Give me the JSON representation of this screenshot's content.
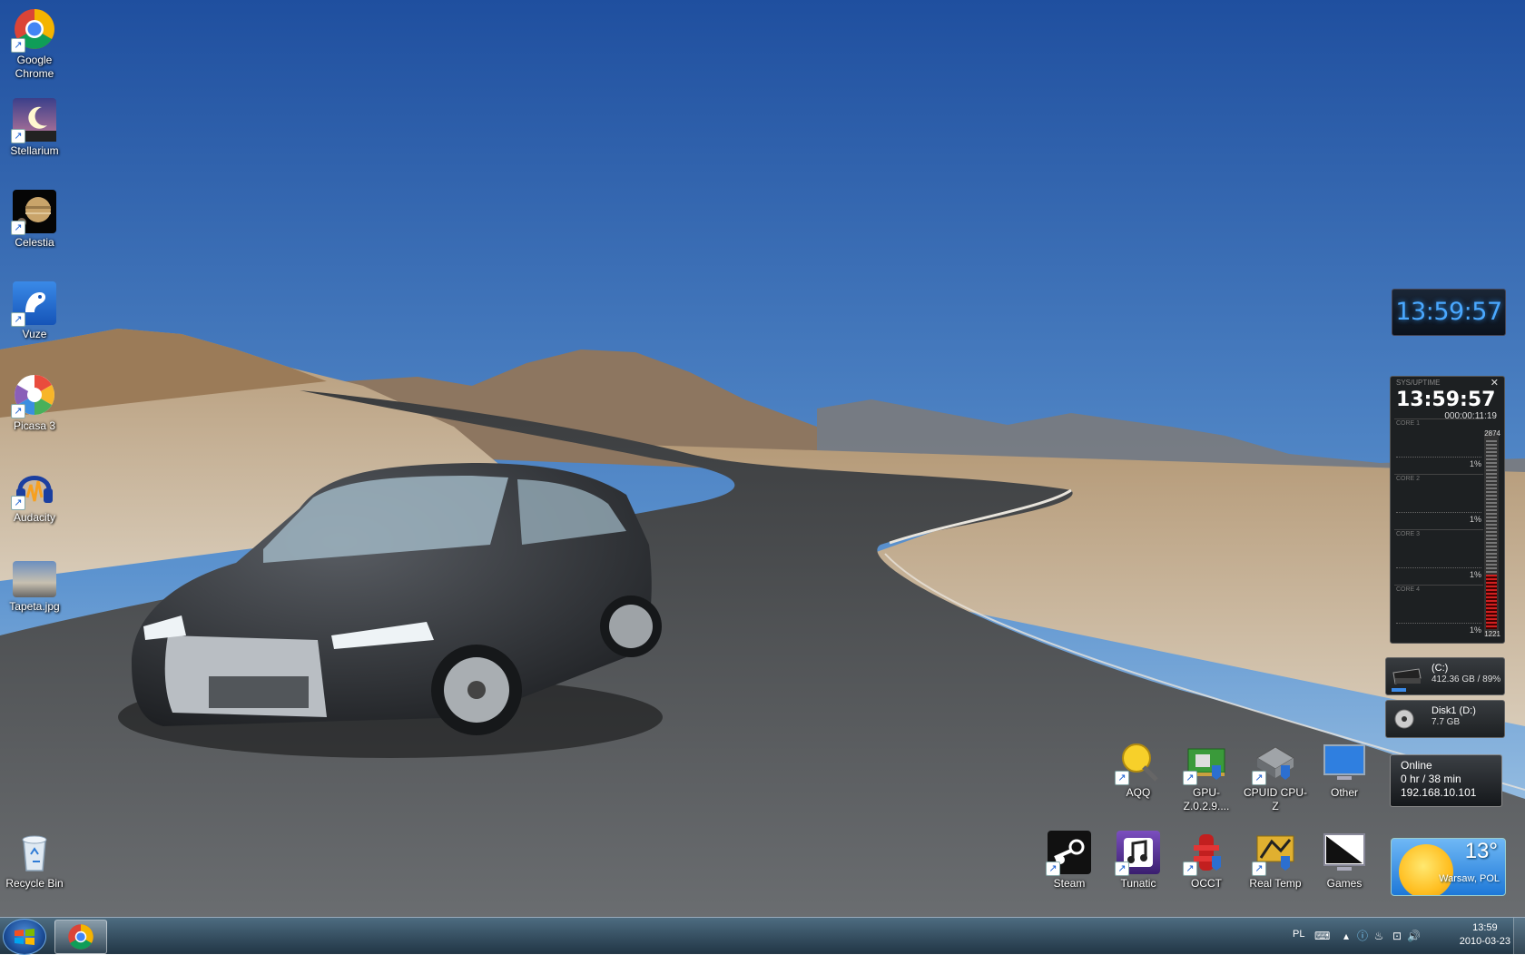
{
  "desktop": {
    "left_icons": [
      {
        "label": "Google\nChrome",
        "icon": "chrome-icon"
      },
      {
        "label": "Stellarium",
        "icon": "stellarium-icon"
      },
      {
        "label": "Celestia",
        "icon": "celestia-icon"
      },
      {
        "label": "Vuze",
        "icon": "vuze-icon"
      },
      {
        "label": "Picasa 3",
        "icon": "picasa-icon"
      },
      {
        "label": "Audacity",
        "icon": "audacity-icon"
      },
      {
        "label": "Tapeta.jpg",
        "icon": "image-file-icon"
      },
      {
        "label": "Recycle Bin",
        "icon": "recycle-bin-icon"
      }
    ],
    "right_icons_row1": [
      {
        "label": "AQQ",
        "icon": "aqq-icon"
      },
      {
        "label": "GPU-Z.0.2.9....",
        "icon": "gpuz-icon"
      },
      {
        "label": "CPUID CPU-Z",
        "icon": "cpuz-icon"
      },
      {
        "label": "Other",
        "icon": "monitor-icon"
      }
    ],
    "right_icons_row2": [
      {
        "label": "Steam",
        "icon": "steam-icon"
      },
      {
        "label": "Tunatic",
        "icon": "tunatic-icon"
      },
      {
        "label": "OCCT",
        "icon": "occt-icon"
      },
      {
        "label": "Real Temp",
        "icon": "realtemp-icon"
      },
      {
        "label": "Games",
        "icon": "games-icon"
      }
    ]
  },
  "gadgets": {
    "clock": {
      "time": "13:59:57"
    },
    "cpu_meter": {
      "header": "SYS/UPTIME",
      "time": "13:59:57",
      "uptime": "000:00:11:19",
      "cores": [
        {
          "name": "CORE 1",
          "pct": "1%"
        },
        {
          "name": "CORE 2",
          "pct": "1%"
        },
        {
          "name": "CORE 3",
          "pct": "1%"
        },
        {
          "name": "CORE 4",
          "pct": "1%"
        }
      ],
      "mem_total": "2874",
      "mem_used": "1221"
    },
    "drives": [
      {
        "name": "(C:)",
        "size": "412.36 GB / 89%"
      },
      {
        "name": "Disk1 (D:)",
        "size": "7.7 GB"
      }
    ],
    "network": {
      "status": "Online",
      "duration": "0 hr / 38 min",
      "ip": "192.168.10.101"
    },
    "weather": {
      "temp": "13°",
      "city": "Warsaw, POL"
    }
  },
  "taskbar": {
    "language": "PL",
    "clock_time": "13:59",
    "clock_date": "2010-03-23",
    "pinned": [
      {
        "name": "Google Chrome",
        "icon": "chrome-icon"
      }
    ]
  },
  "colors": {
    "sky_top": "#1f4f9f",
    "sky_bottom": "#a9cce8",
    "clock_digits": "#4aa8ff",
    "weather_bg": "#2d86e0"
  }
}
